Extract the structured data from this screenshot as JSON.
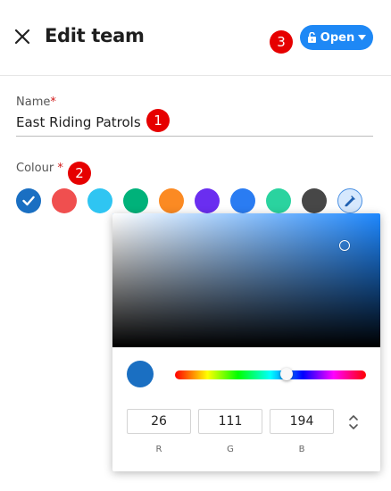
{
  "header": {
    "title": "Edit team",
    "open_label": "Open"
  },
  "badges": [
    "1",
    "2",
    "3"
  ],
  "form": {
    "name_label": "Name",
    "name_required": "*",
    "name_value": "East Riding Patrols",
    "colour_label": "Colour",
    "colour_required": "*"
  },
  "swatches": [
    {
      "color": "#1a6fc2",
      "selected": true
    },
    {
      "color": "#f04f4f",
      "selected": false
    },
    {
      "color": "#2fc5f2",
      "selected": false
    },
    {
      "color": "#00b27a",
      "selected": false
    },
    {
      "color": "#fb8a23",
      "selected": false
    },
    {
      "color": "#6a2ef0",
      "selected": false
    },
    {
      "color": "#2a7cf2",
      "selected": false
    },
    {
      "color": "#2ad39f",
      "selected": false
    },
    {
      "color": "#474747",
      "selected": false
    },
    {
      "icon": "eyedropper-icon",
      "color": "#4a90e2",
      "selected": false
    }
  ],
  "picker": {
    "hue_color": "#1e88ff",
    "preview_color": "#1a6fc2",
    "r": "26",
    "g": "111",
    "b": "194",
    "r_label": "R",
    "g_label": "G",
    "b_label": "B"
  },
  "colors": {
    "accent": "#1e88f5",
    "badge": "#e60000",
    "required": "#d11a1a"
  }
}
